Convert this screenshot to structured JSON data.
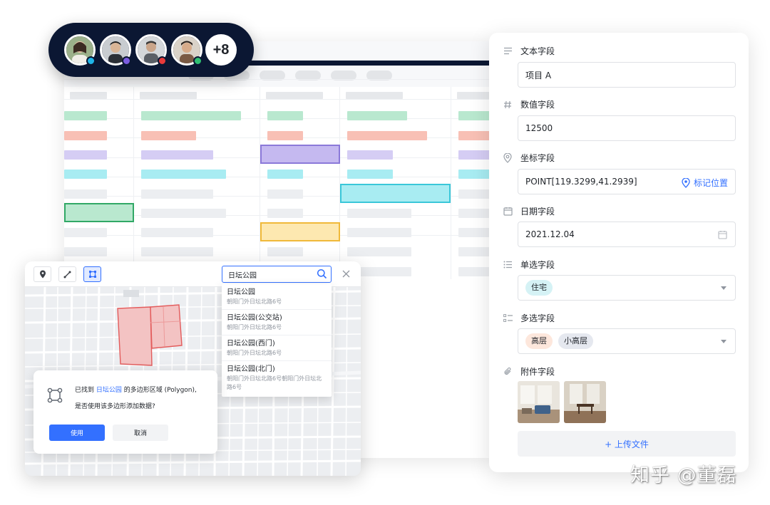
{
  "form": {
    "fields": [
      {
        "label": "文本字段",
        "icon": "text-lines-icon",
        "value": "项目 A"
      },
      {
        "label": "数值字段",
        "icon": "hash-icon",
        "value": "12500"
      },
      {
        "label": "坐标字段",
        "icon": "location-pin-icon",
        "value": "POINT[119.3299,41.2939]",
        "action_label": "标记位置"
      },
      {
        "label": "日期字段",
        "icon": "calendar-icon",
        "value": "2021.12.04"
      },
      {
        "label": "单选字段",
        "icon": "list-icon",
        "tags": [
          "住宅"
        ]
      },
      {
        "label": "多选字段",
        "icon": "checklist-icon",
        "tags": [
          "高层",
          "小高层"
        ]
      },
      {
        "label": "附件字段",
        "icon": "paperclip-icon"
      }
    ],
    "upload_label": "+ 上传文件"
  },
  "avatars": {
    "status_colors": [
      "#1fb5e8",
      "#7b5ce0",
      "#e83a3a",
      "#2fbf71"
    ],
    "more_label": "+8"
  },
  "map": {
    "search_value": "日坛公园",
    "results": [
      {
        "name": "日坛公园",
        "address": "朝阳门外日坛北路6号"
      },
      {
        "name": "日坛公园(公交站)",
        "address": "朝阳门外日坛北路6号"
      },
      {
        "name": "日坛公园(西门)",
        "address": "朝阳门外日坛北路6号"
      },
      {
        "name": "日坛公园(北门)",
        "address": "朝阳门外日坛北路6号朝阳门外日坛北路6号"
      }
    ],
    "dialog": {
      "prefix": "已找到",
      "place": "日坛公园",
      "suffix": "的多边形区域 (Polygon),",
      "question": "是否使用该多边形添加数据?",
      "confirm_label": "使用",
      "cancel_label": "取消"
    }
  },
  "colors": {
    "accent": "#3370ff",
    "header_dark": "#0b1733",
    "green": "#b9e8cf",
    "red": "#f8c0b5",
    "purple": "#d5cdf4",
    "cyan": "#a8ecf2",
    "polygon_fill": "#f3c3c3",
    "polygon_stroke": "#e35b5b"
  },
  "watermark": "知乎 @董磊"
}
